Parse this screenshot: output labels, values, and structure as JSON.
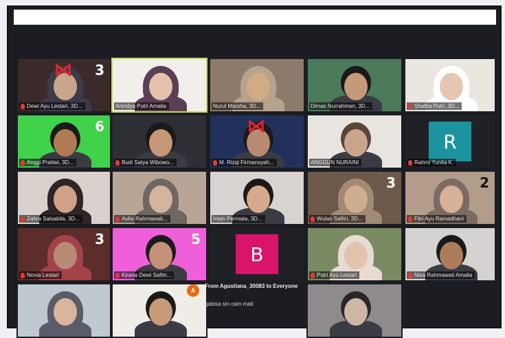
{
  "window": {
    "topbar_color": "#ffffff",
    "background": "#1b1d22"
  },
  "participants": [
    {
      "name": "Dewi Ayu Lestari, 3D...",
      "count": "3",
      "cam": "#3a2b2a",
      "skin": "#c9a58c",
      "hijab": "#3d3b4a",
      "bow": true,
      "mic": "muted"
    },
    {
      "name": "Anindya Putri Amalia",
      "count": "",
      "cam": "#f2eeec",
      "skin": "#e6c2ad",
      "hijab": "#5a3f56",
      "active": true,
      "mic": "on"
    },
    {
      "name": "Nurul Marsha, 3D...",
      "count": "",
      "cam": "#8c7a6b",
      "skin": "#d1aa86",
      "hijab": "#b7a28c",
      "mic": "on"
    },
    {
      "name": "Dimas Nurrahman, 3D...",
      "count": "",
      "cam": "#4a7a5a",
      "skin": "#c59a7a",
      "hair": "#1a1a1a",
      "mic": "on"
    },
    {
      "name": "Shafira Putri, 3D...",
      "count": "",
      "cam": "#ece6e0",
      "skin": "#e4c7b3",
      "hijab": "#ffffff",
      "mic": "muted"
    },
    {
      "name": "Anggi Pratiwi, 3D...",
      "count": "6",
      "cam": "#3fd24a",
      "skin": "#b07b54",
      "hair": "#1a1a1a",
      "mic": "muted"
    },
    {
      "name": "Budi Satya Wibowo...",
      "count": "",
      "cam": "#2d2f35",
      "skin": "#c69775",
      "hair": "#1a1a1a",
      "mic": "muted"
    },
    {
      "name": "M. Rizqi Firmansyah...",
      "count": "",
      "cam": "#22305c",
      "skin": "#b88b70",
      "hair": "#1a1a1a",
      "bow": true,
      "mic": "muted"
    },
    {
      "name": "ANGGUN NURAINI",
      "count": "",
      "cam": "#e8e4e0",
      "skin": "#caa58e",
      "hair": "#5a4538",
      "mic": "on"
    },
    {
      "name": "Rahmi Yunita K.",
      "initial": "R",
      "initial_bg": "#1b94a0",
      "mic": "muted"
    },
    {
      "name": "Zahra Salsabila, 3D...",
      "count": "",
      "cam": "#d9d2cc",
      "skin": "#cfa287",
      "hijab": "#2f2426",
      "mic": "muted"
    },
    {
      "name": "Aulia Rahmawati...",
      "count": "",
      "cam": "#b9a596",
      "skin": "#d4b49c",
      "hijab": "#6f6762",
      "mic": "muted"
    },
    {
      "name": "Intan Permata, 3D...",
      "count": "",
      "cam": "#d8d2d0",
      "skin": "#d4a98c",
      "hair": "#1c1818",
      "mic": "on"
    },
    {
      "name": "Wulan Safitri, 3D...",
      "count": "3",
      "cam": "#6d5949",
      "skin": "#d1ad90",
      "hijab": "#a28a74",
      "mic": "muted"
    },
    {
      "name": "Fitri Ayu Ramadhani",
      "count": "2",
      "cam": "#b39c8a",
      "skin": "#d8b198",
      "hijab": "#7b6c63",
      "mic": "muted"
    },
    {
      "name": "Novia Lestari",
      "count": "3",
      "cam": "#5c2d2b",
      "skin": "#b98a74",
      "hijab": "#a4424a",
      "mic": "muted"
    },
    {
      "name": "Kirana Dewi Safitri...",
      "count": "5",
      "cam": "#ee5fd9",
      "skin": "#c49078",
      "hair": "#1a1a1a",
      "mic": "muted"
    },
    {
      "name": "",
      "initial": "B",
      "initial_bg": "#d9146a",
      "mic": "none"
    },
    {
      "name": "Putri Ayu Lestari",
      "count": "",
      "cam": "#7a8a62",
      "skin": "#e2c3ad",
      "hijab": "#e8dcd2",
      "mic": "muted"
    },
    {
      "name": "Nisa Rahmawati Amalia",
      "count": "",
      "cam": "#d6d2d1",
      "skin": "#ad7d5b",
      "hair": "#1a1a1a",
      "mic": "muted"
    },
    {
      "name": "",
      "count": "",
      "cam": "#bfc9cf",
      "skin": "#d8b59c",
      "hijab": "#5a5c6a",
      "mic": "none"
    },
    {
      "name": "",
      "count": "",
      "cam": "#f0ece8",
      "skin": "#c99a78",
      "hair": "#1a1a1a",
      "mic": "none"
    },
    {
      "name": "",
      "count": "",
      "cam": "#c9a97a",
      "skin": "#d0a582",
      "hair": "#2a2020",
      "mic": "none"
    },
    {
      "name": "",
      "count": "",
      "cam": "#8f8b8c",
      "skin": "#cdb6a6",
      "hair": "#2a2626",
      "mic": "none"
    }
  ],
  "chat": {
    "avatar_letter": "A",
    "from": "From Agustiana_30083 to Everyone",
    "message": "gabisa sin cam mati"
  }
}
